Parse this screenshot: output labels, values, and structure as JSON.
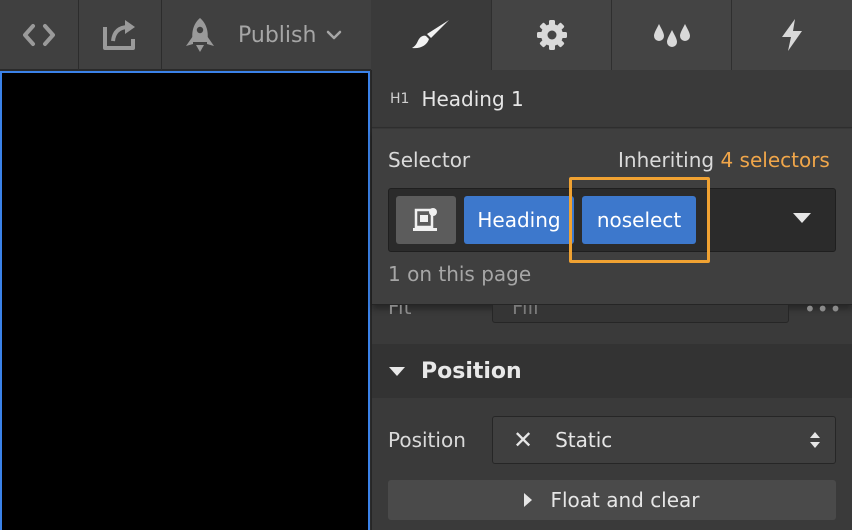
{
  "toolbar": {
    "publish_label": "Publish",
    "icons": [
      "code-icon",
      "export-icon",
      "rocket-icon",
      "chevron-down-icon"
    ]
  },
  "tabs": [
    {
      "name": "style",
      "icon": "paintbrush-icon",
      "active": true
    },
    {
      "name": "settings",
      "icon": "gear-icon",
      "active": false
    },
    {
      "name": "style-manager",
      "icon": "droplets-icon",
      "active": false
    },
    {
      "name": "interactions",
      "icon": "lightning-icon",
      "active": false
    }
  ],
  "element": {
    "badge": "H1",
    "name": "Heading 1"
  },
  "selector": {
    "label": "Selector",
    "inheriting_prefix": "Inheriting",
    "inheriting_count": "4 selectors",
    "tokens": [
      "Heading",
      "noselect"
    ],
    "on_page": "1 on this page"
  },
  "fit": {
    "label": "Fit",
    "value": "Fill"
  },
  "position_section": {
    "title": "Position",
    "field_label": "Position",
    "value": "Static",
    "value_icon": "x-icon"
  },
  "float_clear": {
    "label": "Float and clear"
  },
  "colors": {
    "accent_blue": "#3d78cc",
    "highlight_orange": "#f0a232",
    "count_orange": "#f0a64a"
  }
}
